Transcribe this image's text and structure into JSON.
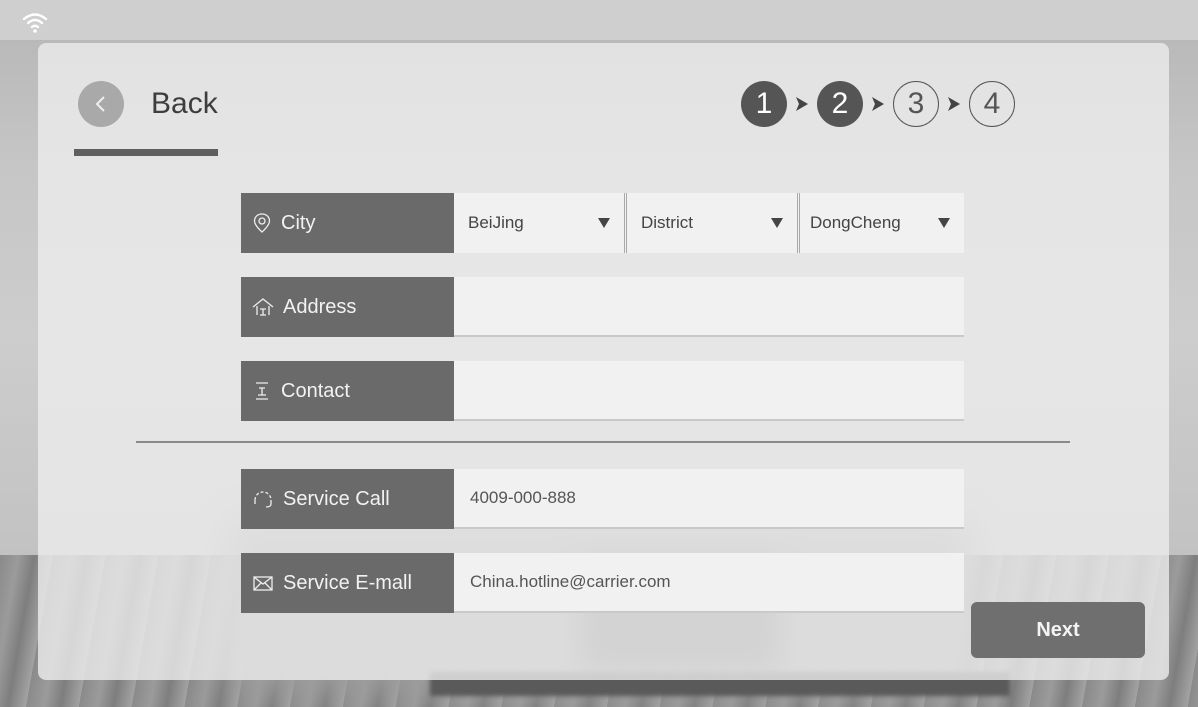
{
  "header": {
    "back_label": "Back",
    "steps": [
      "1",
      "2",
      "3",
      "4"
    ],
    "current_step": 2
  },
  "form": {
    "city": {
      "label": "City",
      "city_value": "BeiJing",
      "district_value": "District",
      "area_value": "DongCheng"
    },
    "address": {
      "label": "Address",
      "value": ""
    },
    "contact": {
      "label": "Contact",
      "value": ""
    },
    "service_call": {
      "label": "Service Call",
      "value": "4009-000-888"
    },
    "service_email": {
      "label": "Service E-mall",
      "value": "China.hotline@carrier.com"
    }
  },
  "actions": {
    "next_label": "Next"
  },
  "icons": {
    "wifi": "wifi-icon",
    "back": "chevron-left-icon",
    "city": "location-pin-icon",
    "address": "home-icon",
    "contact": "contact-icon",
    "service_call": "headset-icon",
    "service_email": "mail-icon"
  },
  "colors": {
    "accent": "#555555",
    "label_bg": "#6a6a6a",
    "field_bg": "#f1f1f1"
  }
}
